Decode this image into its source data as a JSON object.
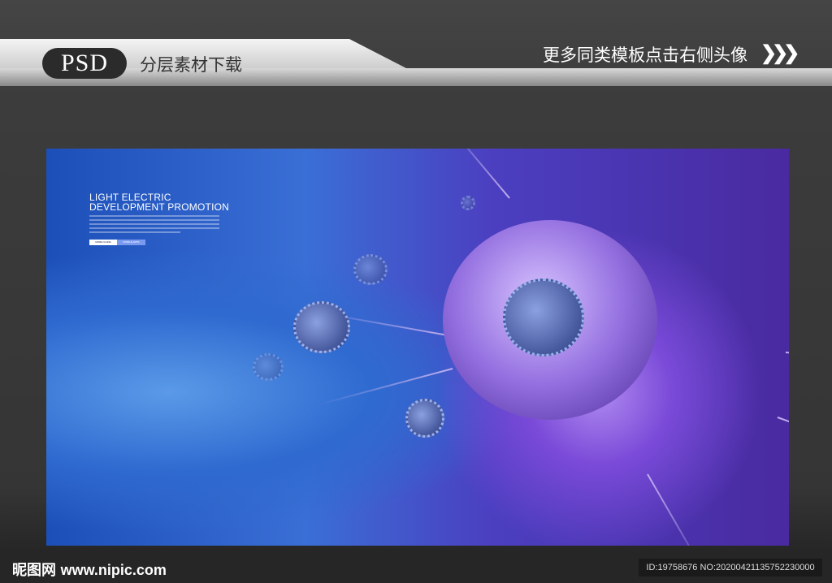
{
  "header": {
    "badge": "PSD",
    "subtitle": "分层素材下载",
    "right_text": "更多同类模板点击右侧头像",
    "arrows": "❯❯❯"
  },
  "poster": {
    "title_line1": "LIGHT ELECTRIC",
    "title_line2": "DEVELOPMENT PROMOTION",
    "button1": "MORE GUIDE",
    "button2": "MOBILE APPS"
  },
  "footer": {
    "logo_cn": "昵图网",
    "logo_url": "www.nipic.com",
    "id_text": "ID:19758676 NO:20200421135752230000"
  }
}
